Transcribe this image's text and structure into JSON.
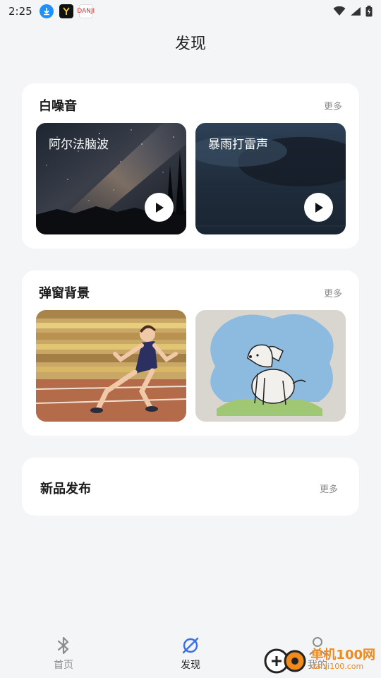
{
  "status_bar": {
    "time": "2:25",
    "app2_text": "DANJI"
  },
  "page": {
    "title": "发现"
  },
  "white_noise": {
    "title": "白噪音",
    "more": "更多",
    "items": [
      {
        "label": "阿尔法脑波",
        "icon": "play-icon"
      },
      {
        "label": "暴雨打雷声",
        "icon": "play-icon"
      }
    ]
  },
  "popup_bg": {
    "title": "弹窗背景",
    "more": "更多"
  },
  "new_release": {
    "title": "新品发布",
    "more": "更多"
  },
  "bottom_nav": {
    "items": [
      {
        "label": "首页",
        "icon": "bluetooth-icon",
        "active": false
      },
      {
        "label": "发现",
        "icon": "planet-icon",
        "active": true
      },
      {
        "label": "我的",
        "icon": "person-icon",
        "active": false
      }
    ]
  },
  "watermark": {
    "main": "单机100网",
    "sub": "danji100.com"
  },
  "colors": {
    "accent": "#3a6fe8",
    "background": "#f4f5f7",
    "card": "#ffffff"
  }
}
